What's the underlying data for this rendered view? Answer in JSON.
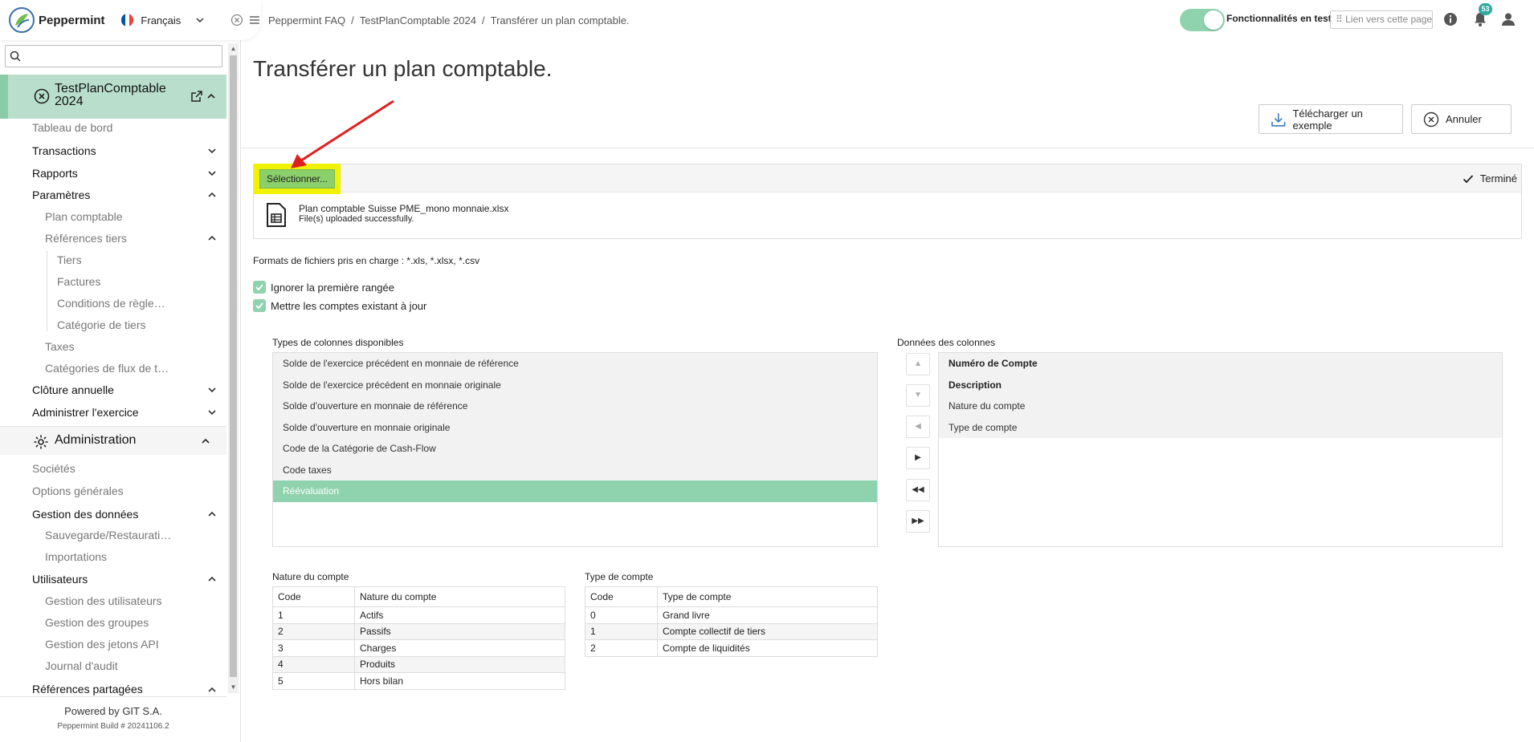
{
  "app": {
    "name": "Peppermint",
    "language": "Français",
    "flag_colors": [
      "#0055a4",
      "#ffffff",
      "#ef4135"
    ]
  },
  "sidebar": {
    "search_placeholder": "",
    "active_item": "TestPlanComptable 2024",
    "items": {
      "tableau_de_bord": "Tableau de bord",
      "transactions": "Transactions",
      "rapports": "Rapports",
      "parametres": "Paramètres",
      "plan_comptable": "Plan comptable",
      "references_tiers": "Références tiers",
      "tiers": "Tiers",
      "factures": "Factures",
      "conditions": "Conditions de règle…",
      "categorie_tiers": "Catégorie de tiers",
      "taxes": "Taxes",
      "categories_flux": "Catégories de flux de t…",
      "cloture": "Clôture annuelle",
      "administrer": "Administrer l'exercice"
    },
    "admin_section": "Administration",
    "admin_items": {
      "societes": "Sociétés",
      "options": "Options générales",
      "gestion_donnees": "Gestion des données",
      "sauvegarde": "Sauvegarde/Restaurati…",
      "importations": "Importations",
      "utilisateurs": "Utilisateurs",
      "gestion_utilisateurs": "Gestion des utilisateurs",
      "gestion_groupes": "Gestion des groupes",
      "gestion_jetons": "Gestion des jetons API",
      "journal": "Journal d'audit",
      "references_partagees": "Références partagées"
    },
    "footer": {
      "powered": "Powered by GIT S.A.",
      "build": "Peppermint Build # 20241106.2"
    }
  },
  "header": {
    "breadcrumb": [
      "Peppermint FAQ",
      "TestPlanComptable 2024",
      "Transférer un plan comptable."
    ],
    "breadcrumb_sep": "/",
    "feature_toggle_label": "Fonctionnalités en test",
    "feature_toggle_on": true,
    "link_button": "⠿ Lien vers cette page",
    "notification_count": "53"
  },
  "main": {
    "title": "Transférer un plan comptable.",
    "download_button": "Télécharger un exemple",
    "cancel_button": "Annuler",
    "upload": {
      "select_button": "Sélectionner...",
      "status": "Terminé",
      "file_name": "Plan comptable Suisse PME_mono monnaie.xlsx",
      "file_status": "File(s) uploaded successfully."
    },
    "formats_text": "Formats de fichiers pris en charge : *.xls, *.xlsx, *.csv",
    "checkboxes": [
      {
        "label": "Ignorer la première rangée",
        "checked": true
      },
      {
        "label": "Mettre les comptes existant à jour",
        "checked": true
      }
    ],
    "available_label": "Types de colonnes disponibles",
    "available_columns": [
      "Solde de l'exercice précédent en monnaie de référence",
      "Solde de l'exercice précédent en monnaie originale",
      "Solde d'ouverture en monnaie de référence",
      "Solde d'ouverture en monnaie originale",
      "Code de la Catégorie de Cash-Flow",
      "Code taxes",
      "Réévaluation"
    ],
    "selected_available": "Réévaluation",
    "data_label": "Données des colonnes",
    "data_columns": [
      "Numéro de Compte",
      "Description",
      "Nature du compte",
      "Type de compte"
    ],
    "data_columns_bold": [
      "Numéro de Compte",
      "Description"
    ],
    "arrow_buttons": [
      "▲",
      "▼",
      "◀",
      "▶",
      "◀◀",
      "▶▶"
    ],
    "nature_table": {
      "title": "Nature du compte",
      "headers": [
        "Code",
        "Nature du compte"
      ],
      "rows": [
        [
          "1",
          "Actifs"
        ],
        [
          "2",
          "Passifs"
        ],
        [
          "3",
          "Charges"
        ],
        [
          "4",
          "Produits"
        ],
        [
          "5",
          "Hors bilan"
        ]
      ]
    },
    "type_table": {
      "title": "Type de compte",
      "headers": [
        "Code",
        "Type de compte"
      ],
      "rows": [
        [
          "0",
          "Grand livre"
        ],
        [
          "1",
          "Compte collectif de tiers"
        ],
        [
          "2",
          "Compte de liquidités"
        ]
      ]
    }
  },
  "colors": {
    "accent_green": "#8fd3ae",
    "active_bg": "#b9dfcc",
    "highlight_yellow": "#f0f200",
    "select_button_green": "#8bd06a",
    "annotation_red": "#e02020",
    "badge_teal": "#2eaaa0"
  }
}
